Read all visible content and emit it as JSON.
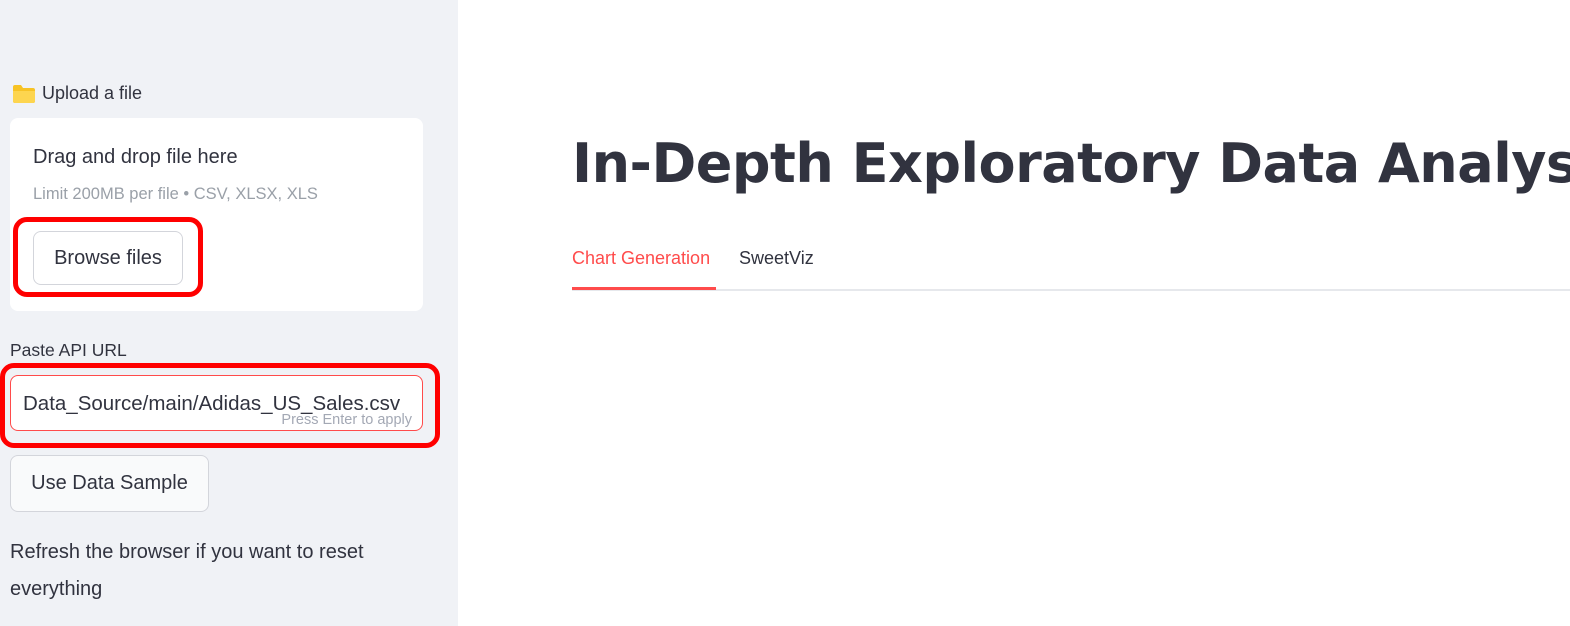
{
  "sidebar": {
    "upload_label": "Upload a file",
    "dropzone_title": "Drag and drop file here",
    "dropzone_limit": "Limit 200MB per file • CSV, XLSX, XLS",
    "browse_button": "Browse files",
    "api_label": "Paste API URL",
    "api_value": "Data_Source/main/Adidas_US_Sales.csv",
    "api_hint": "Press Enter to apply",
    "sample_button": "Use Data Sample",
    "refresh_text": "Refresh the browser if you want to reset everything"
  },
  "main": {
    "title": "In-Depth Exploratory Data Analysis",
    "tabs": [
      {
        "label": "Chart Generation",
        "active": true
      },
      {
        "label": "SweetViz",
        "active": false
      }
    ]
  },
  "colors": {
    "accent": "#ff4b4b",
    "sidebar_bg": "#f0f2f6",
    "highlight": "#ff0000",
    "text": "#31333f"
  },
  "icons": {
    "upload": "folder-icon"
  }
}
